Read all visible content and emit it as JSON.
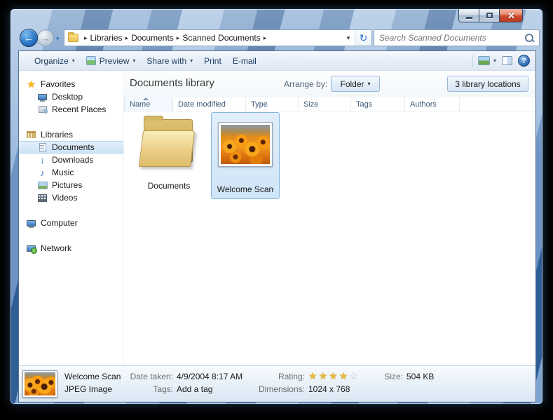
{
  "navbar": {
    "breadcrumb": [
      "Libraries",
      "Documents",
      "Scanned Documents"
    ],
    "search_placeholder": "Search Scanned Documents"
  },
  "icons": {
    "back": "←",
    "forward": "→",
    "refresh": "↻",
    "dropdown": "▾",
    "breadcrumb_arrow": "▸",
    "help": "?",
    "music_note": "♪",
    "download_arrow": "↓",
    "favorites_star": "★"
  },
  "toolbar": {
    "organize": "Organize",
    "preview": "Preview",
    "share_with": "Share with",
    "print": "Print",
    "email": "E-mail"
  },
  "sidebar": {
    "favorites": {
      "label": "Favorites"
    },
    "desktop": {
      "label": "Desktop"
    },
    "recent_places": {
      "label": "Recent Places"
    },
    "libraries": {
      "label": "Libraries"
    },
    "documents": {
      "label": "Documents"
    },
    "downloads": {
      "label": "Downloads"
    },
    "music": {
      "label": "Music"
    },
    "pictures": {
      "label": "Pictures"
    },
    "videos": {
      "label": "Videos"
    },
    "computer": {
      "label": "Computer"
    },
    "network": {
      "label": "Network"
    }
  },
  "library_header": {
    "title": "Documents library",
    "arrange_label": "Arrange by:",
    "arrange_value": "Folder",
    "locations_button": "3 library locations"
  },
  "columns": {
    "name": "Name",
    "date_modified": "Date modified",
    "type": "Type",
    "size": "Size",
    "tags": "Tags",
    "authors": "Authors"
  },
  "files": {
    "folder": {
      "label": "Documents"
    },
    "image": {
      "label": "Welcome Scan",
      "selected": true
    }
  },
  "details": {
    "name": "Welcome Scan",
    "type": "JPEG Image",
    "date_taken_label": "Date taken:",
    "date_taken": "4/9/2004 8:17 AM",
    "tags_label": "Tags:",
    "tags_value": "Add a tag",
    "rating_label": "Rating:",
    "rating": 4,
    "rating_max": 5,
    "dimensions_label": "Dimensions:",
    "dimensions": "1024 x 768",
    "size_label": "Size:",
    "size": "504 KB"
  }
}
